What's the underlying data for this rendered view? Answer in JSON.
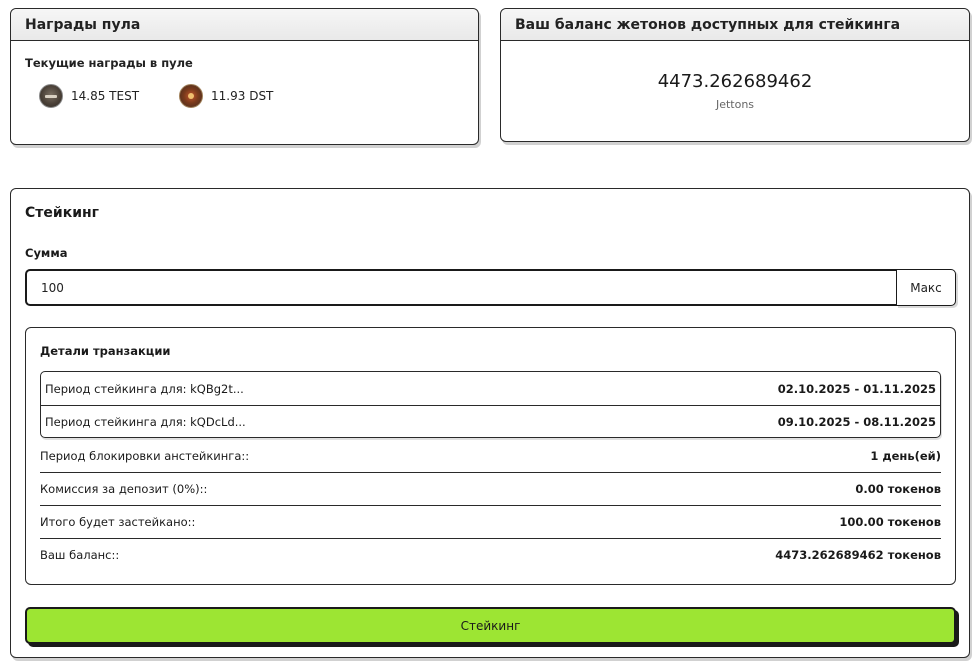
{
  "rewards": {
    "title": "Награды пула",
    "subtitle": "Текущие награды в пуле",
    "items": [
      {
        "icon": "test-token-icon",
        "amount": "14.85 TEST"
      },
      {
        "icon": "dst-token-icon",
        "amount": "11.93 DST"
      }
    ]
  },
  "balance": {
    "title": "Ваш баланс жетонов доступных для стейкинга",
    "value": "4473.262689462",
    "unit": "Jettons"
  },
  "staking": {
    "title": "Стейкинг",
    "amount_label": "Сумма",
    "amount_value": "100",
    "max_label": "Макс",
    "details": {
      "title": "Детали транзакции",
      "periods": [
        {
          "label": "Период стейкинга для: kQBg2t...",
          "value": "02.10.2025 - 01.11.2025"
        },
        {
          "label": "Период стейкинга для: kQDcLd...",
          "value": "09.10.2025 - 08.11.2025"
        }
      ],
      "rows": [
        {
          "label": "Период блокировки анстейкинга::",
          "value": "1 день(ей)"
        },
        {
          "label": "Комиссия за депозит (0%)::",
          "value": "0.00 токенов"
        },
        {
          "label": "Итого будет застейкано::",
          "value": "100.00 токенов"
        },
        {
          "label": "Ваш баланс::",
          "value": "4473.262689462 токенов"
        }
      ]
    },
    "submit_label": "Стейкинг"
  },
  "colors": {
    "accent": "#9de533",
    "border": "#2a2a2a"
  }
}
